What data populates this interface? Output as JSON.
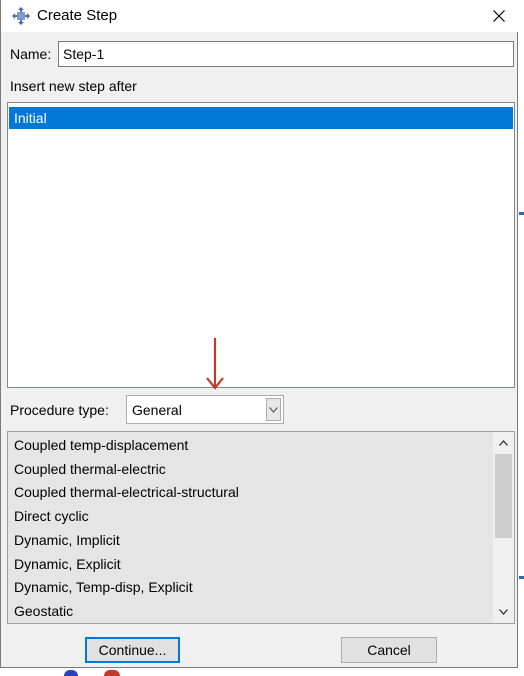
{
  "window": {
    "title": "Create Step",
    "app_icon": "abaqus-step-icon",
    "close_icon": "close-icon"
  },
  "name": {
    "label": "Name:",
    "value": "Step-1"
  },
  "insert_after": {
    "label": "Insert new step after",
    "items": [
      "Initial"
    ],
    "selected": "Initial",
    "selection_color": "#0078d7"
  },
  "annotation": {
    "icon": "red-down-arrow-icon",
    "color": "#c0392b"
  },
  "procedure": {
    "label": "Procedure type:",
    "selected": "General",
    "dropdown_icon": "chevron-down-icon",
    "options": [
      "Coupled temp-displacement",
      "Coupled thermal-electric",
      "Coupled thermal-electrical-structural",
      "Direct cyclic",
      "Dynamic, Implicit",
      "Dynamic, Explicit",
      "Dynamic, Temp-disp, Explicit",
      "Geostatic"
    ]
  },
  "buttons": {
    "continue_label": "Continue...",
    "cancel_label": "Cancel"
  }
}
